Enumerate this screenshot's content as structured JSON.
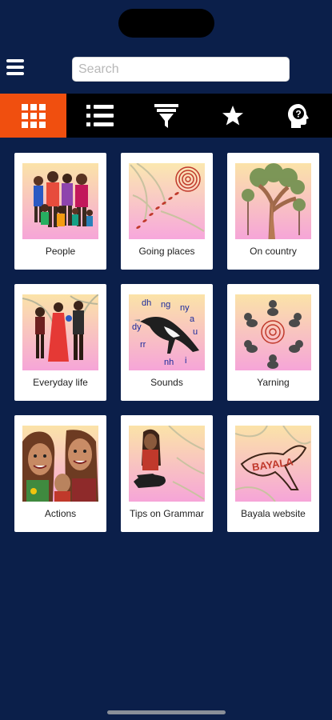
{
  "header": {
    "menu_icon": "hamburger-menu-icon",
    "search_placeholder": "Search",
    "search_value": ""
  },
  "tabs": [
    {
      "id": "grid",
      "icon": "grid-view-icon",
      "active": true
    },
    {
      "id": "list",
      "icon": "list-view-icon",
      "active": false
    },
    {
      "id": "filter",
      "icon": "filter-funnel-icon",
      "active": false
    },
    {
      "id": "favourites",
      "icon": "star-icon",
      "active": false
    },
    {
      "id": "help",
      "icon": "help-head-icon",
      "active": false
    }
  ],
  "categories": [
    {
      "label": "People",
      "icon": "people-illustration"
    },
    {
      "label": "Going places",
      "icon": "going-places-illustration"
    },
    {
      "label": "On country",
      "icon": "on-country-illustration"
    },
    {
      "label": "Everyday life",
      "icon": "everyday-life-illustration"
    },
    {
      "label": "Sounds",
      "icon": "sounds-magpie-illustration",
      "sounds_letters": [
        "dh",
        "ng",
        "ny",
        "a",
        "u",
        "dy",
        "rr",
        "nh",
        "i"
      ]
    },
    {
      "label": "Yarning",
      "icon": "yarning-circle-illustration"
    },
    {
      "label": "Actions",
      "icon": "actions-family-illustration"
    },
    {
      "label": "Tips on Grammar",
      "icon": "grammar-tips-illustration"
    },
    {
      "label": "Bayala website",
      "icon": "bayala-website-illustration",
      "logo_text": "BAYALA"
    }
  ],
  "colors": {
    "background": "#0b1f4a",
    "tab_bar": "#000000",
    "tab_active": "#f04f0f",
    "card": "#ffffff"
  }
}
